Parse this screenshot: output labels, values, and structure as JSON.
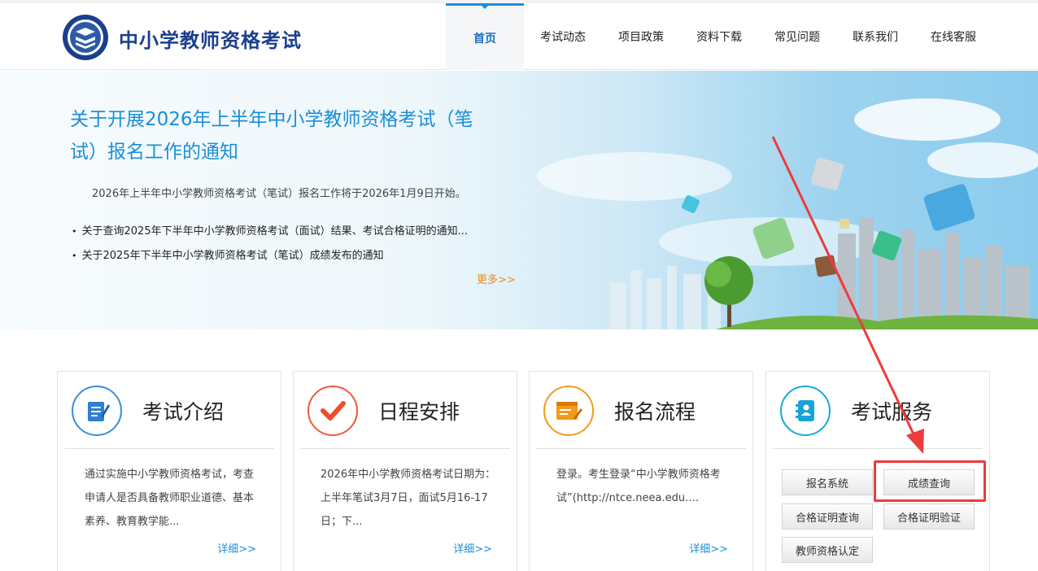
{
  "header": {
    "site_title": "中小学教师资格考试",
    "nav": [
      "首页",
      "考试动态",
      "项目政策",
      "资料下载",
      "常见问题",
      "联系我们",
      "在线客服"
    ]
  },
  "banner": {
    "headline": "关于开展2026年上半年中小学教师资格考试（笔试）报名工作的通知",
    "summary": "2026年上半年中小学教师资格考试（笔试）报名工作将于2026年1月9日开始。",
    "news": [
      "关于查询2025年下半年中小学教师资格考试（面试）结果、考试合格证明的通知...",
      "关于2025年下半年中小学教师资格考试（笔试）成绩发布的通知"
    ],
    "more": "更多>>"
  },
  "cards": [
    {
      "title": "考试介绍",
      "desc": "通过实施中小学教师资格考试，考查申请人是否具备教师职业道德、基本素养、教育教学能...",
      "detail": "详细>>"
    },
    {
      "title": "日程安排",
      "desc": "2026年中小学教师资格考试日期为：上半年笔试3月7日，面试5月16-17日；下...",
      "detail": "详细>>"
    },
    {
      "title": "报名流程",
      "desc": "登录。考生登录“中小学教师资格考试”(http://ntce.neea.edu.…",
      "detail": "详细>>"
    }
  ],
  "service": {
    "title": "考试服务",
    "buttons": [
      "报名系统",
      "成绩查询",
      "合格证明查询",
      "合格证明验证",
      "教师资格认定"
    ]
  },
  "colors": {
    "accent": "#1a8fd6",
    "brand": "#1b3f8f",
    "more": "#ef8a12",
    "annotation": "#ee3b3b"
  }
}
